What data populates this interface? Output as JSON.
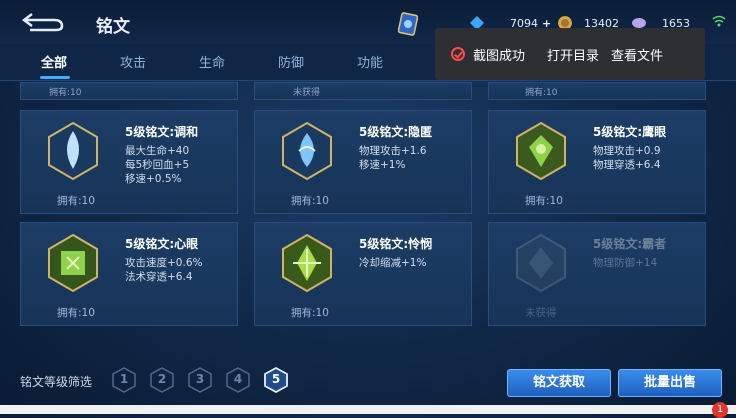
{
  "header": {
    "title": "铭文",
    "currencies": [
      {
        "name": "diamond",
        "value": "7094",
        "color": "#3aa7ff"
      },
      {
        "name": "gold",
        "value": "13402",
        "color": "#d8a848"
      },
      {
        "name": "crystal",
        "value": "1653",
        "color": "#b9a4f0"
      }
    ]
  },
  "tabs": [
    "全部",
    "攻击",
    "生命",
    "防御",
    "功能"
  ],
  "toast": {
    "message": "截图成功",
    "open_dir": "打开目录",
    "view_file": "查看文件"
  },
  "partial_row": [
    "拥有:10",
    "未获得",
    "拥有:10"
  ],
  "cards": [
    {
      "name": "5级铭文:调和",
      "stats": [
        "最大生命+40",
        "每5秒回血+5",
        "移速+0.5%"
      ],
      "own": "拥有:10",
      "color": "#4fa6e8"
    },
    {
      "name": "5级铭文:隐匿",
      "stats": [
        "物理攻击+1.6",
        "移速+1%"
      ],
      "own": "拥有:10",
      "color": "#4fa6e8"
    },
    {
      "name": "5级铭文:鹰眼",
      "stats": [
        "物理攻击+0.9",
        "物理穿透+6.4"
      ],
      "own": "拥有:10",
      "color": "#6dbb3c"
    },
    {
      "name": "5级铭文:心眼",
      "stats": [
        "攻击速度+0.6%",
        "法术穿透+6.4"
      ],
      "own": "拥有:10",
      "color": "#6dbb3c"
    },
    {
      "name": "5级铭文:怜悯",
      "stats": [
        "冷却缩减+1%"
      ],
      "own": "拥有:10",
      "color": "#7fc23a"
    },
    {
      "name": "5级铭文:霸者",
      "stats": [
        "物理防御+14"
      ],
      "own": "未获得",
      "color": "#5b7a8f"
    }
  ],
  "filter": {
    "label": "铭文等级筛选",
    "levels": [
      "1",
      "2",
      "3",
      "4",
      "5"
    ],
    "active": "5"
  },
  "buttons": {
    "obtain": "铭文获取",
    "sell": "批量出售"
  },
  "notification_count": "1"
}
